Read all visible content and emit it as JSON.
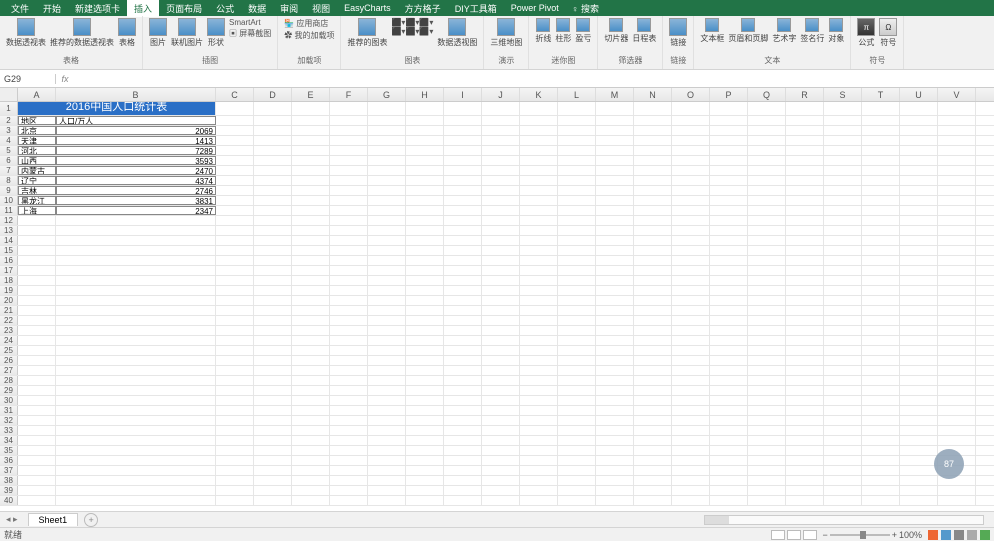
{
  "tabs": {
    "file": "文件",
    "home": "开始",
    "newTab": "新建选项卡",
    "insert": "插入",
    "layout": "页面布局",
    "formula": "公式",
    "data": "数据",
    "review": "审阅",
    "view": "视图",
    "easy": "EasyCharts",
    "square": "方方格子",
    "diy": "DIY工具箱",
    "pivot": "Power Pivot",
    "help": "搜索"
  },
  "ribbon": {
    "tables": {
      "pivot": "数据透视表",
      "recommend": "推荐的数据透视表",
      "table": "表格",
      "label": "表格"
    },
    "illus": {
      "pic": "图片",
      "online": "联机图片",
      "shape": "形状",
      "smart": "SmartArt",
      "screen": "屏幕截图",
      "label": "插图"
    },
    "addins": {
      "app": "应用商店",
      "my": "我的加载项",
      "label": "加载项"
    },
    "charts": {
      "rec": "推荐的图表",
      "pivot": "数据透视图",
      "tour": "三维地图",
      "label": "图表"
    },
    "tours": {
      "label": "演示"
    },
    "spark": {
      "line": "折线",
      "col": "柱形",
      "win": "盈亏",
      "label": "迷你图"
    },
    "filter": {
      "slicer": "切片器",
      "timeline": "日程表",
      "label": "筛选器"
    },
    "link": {
      "link": "链接",
      "label": "链接"
    },
    "text": {
      "textbox": "文本框",
      "header": "页眉和页脚",
      "art": "艺术字",
      "sign": "签名行",
      "obj": "对象",
      "label": "文本"
    },
    "symbol": {
      "eq": "公式",
      "sym": "符号",
      "label": "符号"
    }
  },
  "namebox": "G29",
  "fx": "",
  "columns": [
    "A",
    "B",
    "C",
    "D",
    "E",
    "F",
    "G",
    "H",
    "I",
    "J",
    "K",
    "L",
    "M",
    "N",
    "O",
    "P",
    "Q",
    "R",
    "S",
    "T",
    "U",
    "V"
  ],
  "sheet": {
    "title": "2016中国人口统计表",
    "header": {
      "a": "地区",
      "b": "人口/万人"
    },
    "rows": [
      {
        "a": "北京",
        "b": "2069"
      },
      {
        "a": "天津",
        "b": "1413"
      },
      {
        "a": "河北",
        "b": "7289"
      },
      {
        "a": "山西",
        "b": "3593"
      },
      {
        "a": "内蒙古",
        "b": "2470"
      },
      {
        "a": "辽宁",
        "b": "4374"
      },
      {
        "a": "吉林",
        "b": "2746"
      },
      {
        "a": "黑龙江",
        "b": "3831"
      },
      {
        "a": "上海",
        "b": "2347"
      }
    ]
  },
  "chart_data": {
    "type": "table",
    "title": "2016中国人口统计表",
    "columns": [
      "地区",
      "人口/万人"
    ],
    "rows": [
      [
        "北京",
        2069
      ],
      [
        "天津",
        1413
      ],
      [
        "河北",
        7289
      ],
      [
        "山西",
        3593
      ],
      [
        "内蒙古",
        2470
      ],
      [
        "辽宁",
        4374
      ],
      [
        "吉林",
        2746
      ],
      [
        "黑龙江",
        3831
      ],
      [
        "上海",
        2347
      ]
    ]
  },
  "sheetTab": "Sheet1",
  "status": "就绪",
  "zoom": "100%",
  "floatValue": "87"
}
